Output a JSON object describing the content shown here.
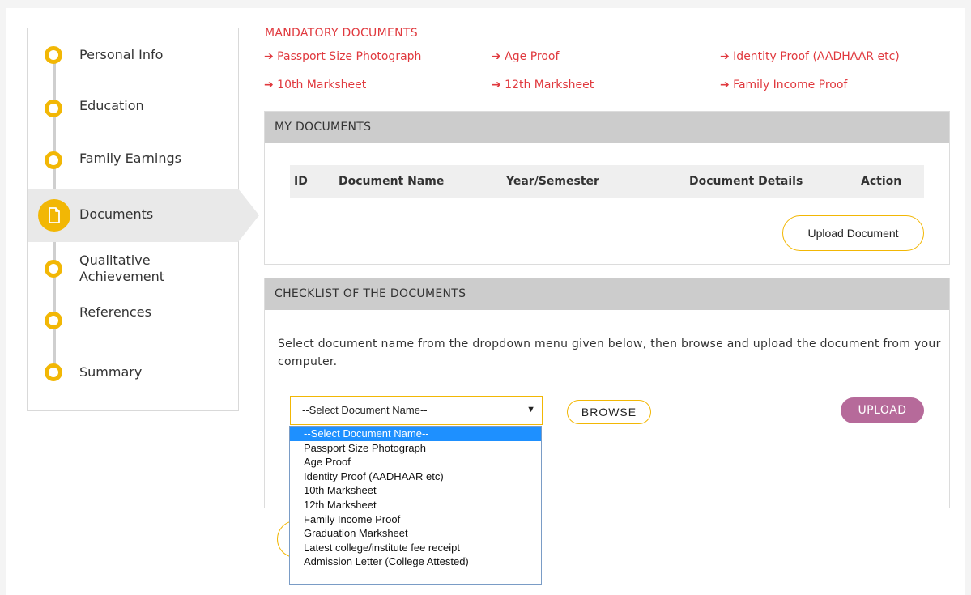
{
  "sidebar": {
    "steps": [
      {
        "label": "Personal Info"
      },
      {
        "label": "Education"
      },
      {
        "label": "Family Earnings"
      },
      {
        "label": "Documents"
      },
      {
        "label": "Qualitative Achievement"
      },
      {
        "label": "References"
      },
      {
        "label": "Summary"
      }
    ],
    "active_step": "Documents"
  },
  "mandatory": {
    "title": "MANDATORY DOCUMENTS",
    "items": [
      "➔ Passport Size Photograph",
      "➔ Age Proof",
      "➔ Identity Proof (AADHAAR etc)",
      "➔ 10th Marksheet",
      "➔ 12th Marksheet",
      "➔ Family Income Proof"
    ]
  },
  "my_documents": {
    "title": "MY DOCUMENTS",
    "columns": [
      "ID",
      "Document Name",
      "Year/Semester",
      "Document Details",
      "Action"
    ],
    "upload_button": "Upload Document"
  },
  "checklist": {
    "title": "CHECKLIST OF THE DOCUMENTS",
    "instructions": "Select document name from the dropdown menu given below, then browse and upload the document from your computer.",
    "select_value": "--Select Document Name--",
    "browse_button": "BROWSE",
    "upload_button": "UPLOAD",
    "options": [
      "--Select Document Name--",
      "Passport Size Photograph",
      "Age Proof",
      "Identity Proof (AADHAAR etc)",
      "10th Marksheet",
      "12th Marksheet",
      "Family Income Proof",
      "Graduation Marksheet",
      "Latest college/institute fee receipt",
      "Admission Letter (College Attested)"
    ]
  },
  "colors": {
    "accent": "#f2b705",
    "mandatory_red": "#e0393e",
    "upload_purple": "#b66a9a",
    "header_gray": "#cccccc",
    "dropdown_selected": "#1e90ff"
  }
}
